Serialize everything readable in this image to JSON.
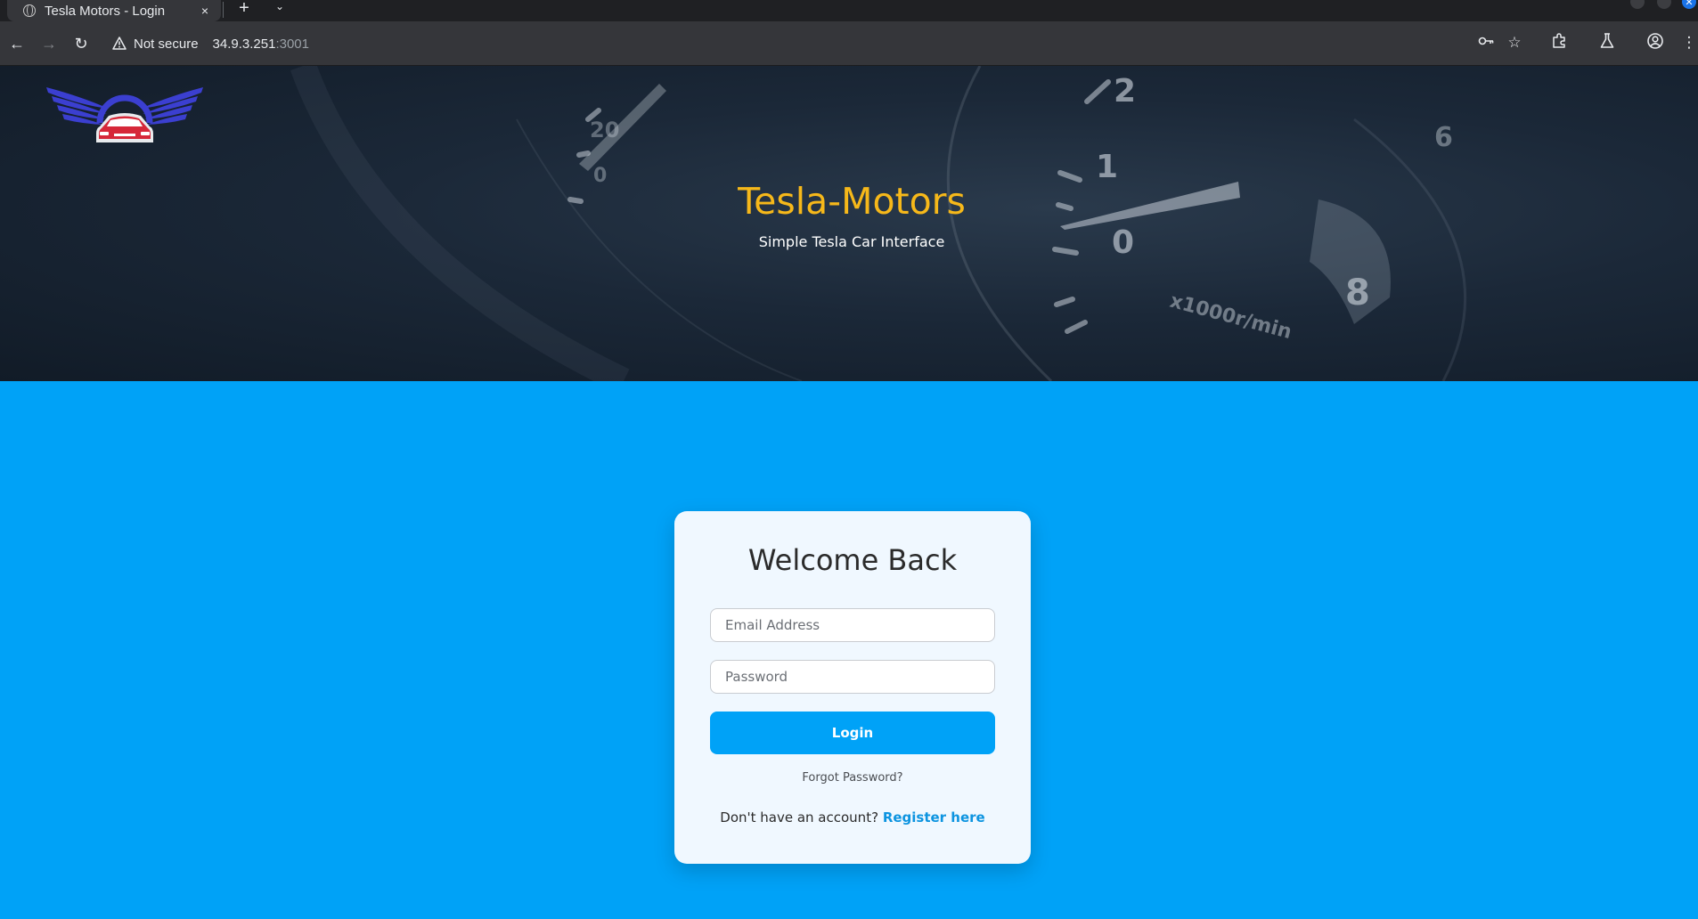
{
  "browser": {
    "tab_title": "Tesla Motors - Login",
    "tab_close": "×",
    "new_tab": "+",
    "tab_search": "⌄",
    "back": "←",
    "forward": "→",
    "reload": "↻",
    "not_secure": "Not secure",
    "url_host": "34.9.3.251",
    "url_port": ":3001",
    "icons": [
      "password-key-icon",
      "star-icon",
      "extensions-icon",
      "labs-icon",
      "profile-icon",
      "menu-icon"
    ]
  },
  "hero": {
    "title": "Tesla-Motors",
    "subtitle": "Simple Tesla Car Interface",
    "title_color": "#f6b81a"
  },
  "login": {
    "heading": "Welcome Back",
    "email_placeholder": "Email Address",
    "password_placeholder": "Password",
    "login_label": "Login",
    "forgot_label": "Forgot Password?",
    "no_account_text": "Don't have an account? ",
    "register_label": "Register here"
  },
  "colors": {
    "page_background": "#00a2f7",
    "card_background": "#f0f8ff",
    "button": "#00a2f7",
    "link": "#0d94e0"
  }
}
